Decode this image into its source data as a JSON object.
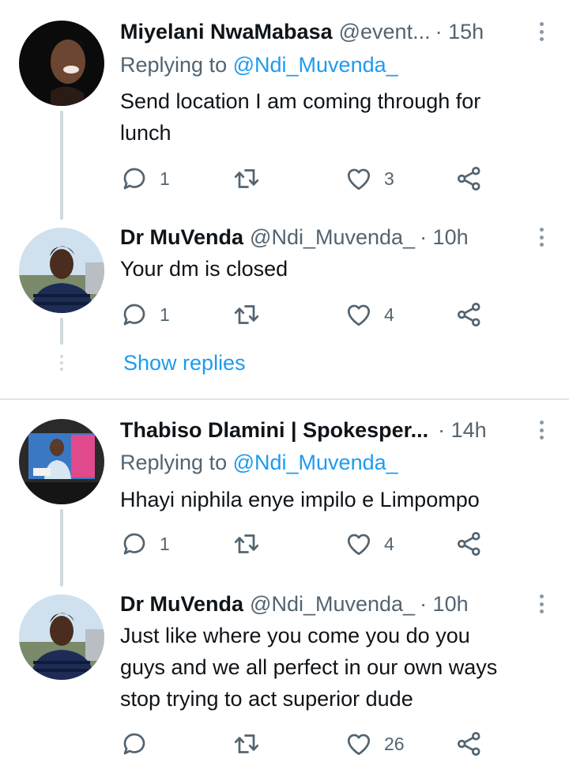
{
  "tweets": [
    {
      "name": "Miyelani NwaMabasa",
      "handle": "@event...",
      "time": "· 15h",
      "replying_prefix": "Replying to",
      "replying_to": "@Ndi_Muvenda_",
      "text_lines": [
        "Send location I am coming through for",
        "lunch"
      ],
      "reply_count": "1",
      "retweet_count": "",
      "like_count": "3"
    },
    {
      "name": "Dr MuVenda",
      "handle": "@Ndi_Muvenda_",
      "time": "· 10h",
      "text_lines": [
        "Your dm is closed"
      ],
      "reply_count": "1",
      "retweet_count": "",
      "like_count": "4"
    },
    {
      "name": "Thabiso Dlamini | Spokesper...",
      "handle": "",
      "time": "· 14h",
      "replying_prefix": "Replying to",
      "replying_to": "@Ndi_Muvenda_",
      "text_lines": [
        "Hhayi niphila enye impilo e Limpompo"
      ],
      "reply_count": "1",
      "retweet_count": "",
      "like_count": "4"
    },
    {
      "name": "Dr MuVenda",
      "handle": "@Ndi_Muvenda_",
      "time": "· 10h",
      "text_lines": [
        "Just like where you come you do you",
        "guys and we all perfect in our own ways",
        "stop trying to act superior dude"
      ],
      "reply_count": "",
      "retweet_count": "",
      "like_count": "26"
    }
  ],
  "show_replies_label": "Show replies",
  "colors": {
    "accent": "#1d9bf0",
    "secondary_text": "#536471",
    "thread_line": "#cfd9de",
    "icon": "#536471"
  },
  "icons": [
    "reply-icon",
    "retweet-icon",
    "like-icon",
    "share-icon",
    "more-icon"
  ]
}
